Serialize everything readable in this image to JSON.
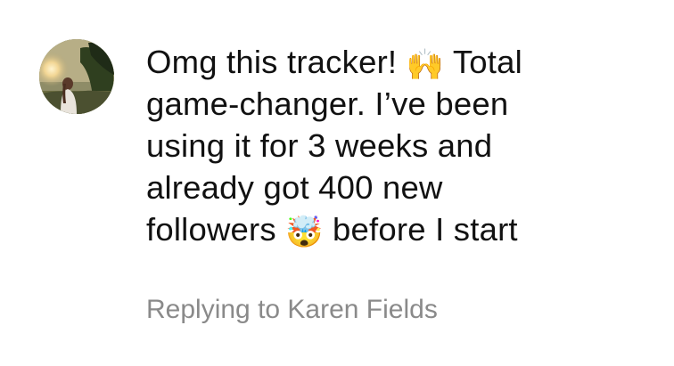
{
  "comment": {
    "avatar_icon": "user-avatar-photo",
    "lines": [
      {
        "before": "Omg this tracker! ",
        "emoji": "🙌",
        "after": " Total"
      },
      {
        "before": "game-changer. I’ve been",
        "emoji": "",
        "after": ""
      },
      {
        "before": "using it for 3 weeks and",
        "emoji": "",
        "after": ""
      },
      {
        "before": "already got 400 new",
        "emoji": "",
        "after": ""
      },
      {
        "before": "followers ",
        "emoji": "🤯",
        "after": " before I start"
      }
    ],
    "reply_meta": "Replying to Karen Fields"
  }
}
